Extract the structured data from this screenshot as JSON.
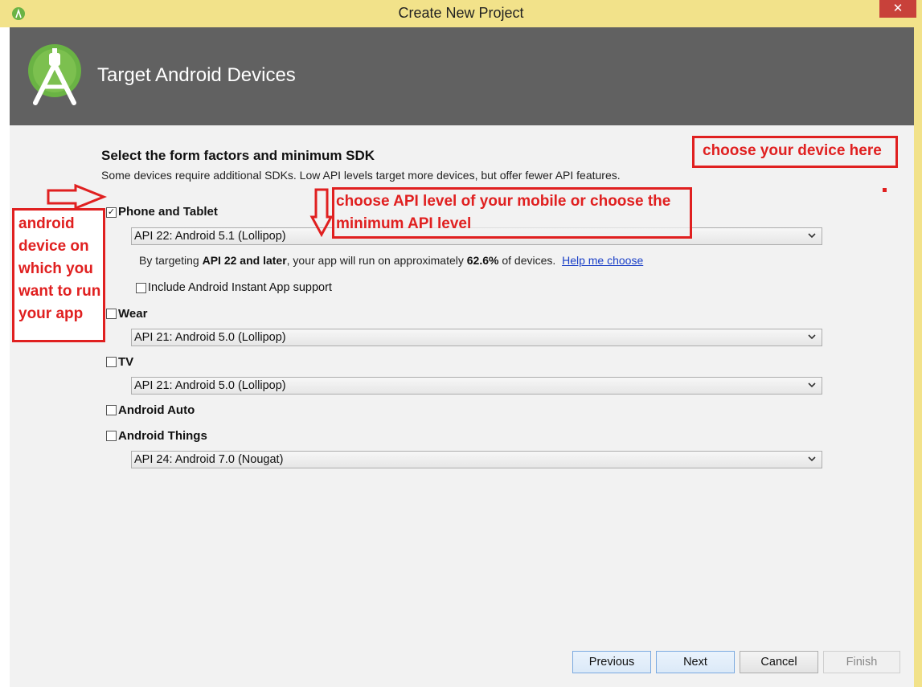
{
  "window": {
    "title": "Create New Project",
    "close_glyph": "✕"
  },
  "header": {
    "title": "Target Android Devices",
    "logo_icon": "android-studio-logo-icon"
  },
  "section": {
    "title": "Select the form factors and minimum SDK",
    "subtitle": "Some devices require additional SDKs. Low API levels target more devices, but offer fewer API features."
  },
  "form_factors": {
    "phone": {
      "label": "Phone and Tablet",
      "checked": true,
      "sdk": "API 22: Android 5.1 (Lollipop)"
    },
    "info": {
      "prefix": "By targeting ",
      "api_bold": "API 22 and later",
      "middle": ", your app will run on approximately ",
      "percent": "62.6%",
      "suffix": " of devices.",
      "link": "Help me choose"
    },
    "instant_app": {
      "label": "Include Android Instant App support",
      "checked": false
    },
    "wear": {
      "label": "Wear",
      "checked": false,
      "sdk": "API 21: Android 5.0 (Lollipop)"
    },
    "tv": {
      "label": "TV",
      "checked": false,
      "sdk": "API 21: Android 5.0 (Lollipop)"
    },
    "auto": {
      "label": "Android Auto",
      "checked": false
    },
    "things": {
      "label": "Android Things",
      "checked": false,
      "sdk": "API 24: Android 7.0 (Nougat)"
    }
  },
  "buttons": {
    "previous": "Previous",
    "next": "Next",
    "cancel": "Cancel",
    "finish": "Finish"
  },
  "annotations": {
    "device_here": "choose your device here",
    "api_level": "choose API level of your mobile or choose the minimum API level",
    "left_note": "android device on which you want to run your app"
  },
  "colors": {
    "accent_annotation": "#e02020",
    "header_bg": "#616161",
    "title_bar": "#f2e28a"
  }
}
